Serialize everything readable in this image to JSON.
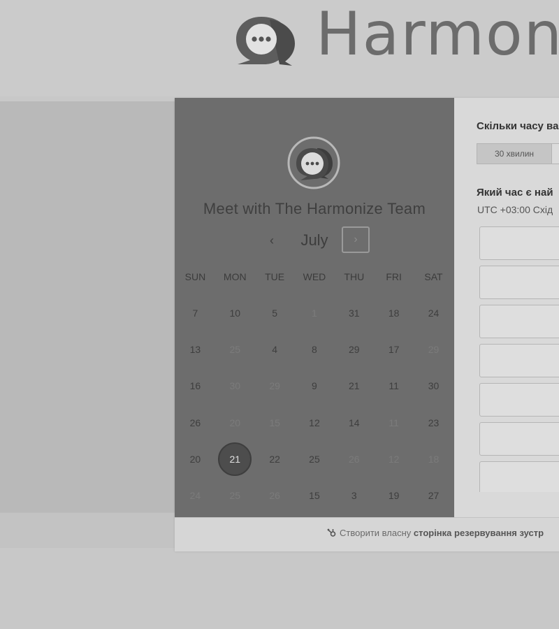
{
  "header": {
    "brand_name": "Harmon"
  },
  "calendar": {
    "team_title": "Meet with The Harmonize Team",
    "month": "July",
    "prev_icon": "chevron-left-icon",
    "next_icon": "chevron-right-icon",
    "prev_glyph": "‹",
    "next_glyph": "›",
    "weekdays": [
      "SUN",
      "MON",
      "TUE",
      "WED",
      "THU",
      "FRI",
      "SAT"
    ],
    "weeks": [
      [
        {
          "d": "7",
          "m": false
        },
        {
          "d": "10",
          "m": false
        },
        {
          "d": "5",
          "m": false
        },
        {
          "d": "1",
          "m": true
        },
        {
          "d": "31",
          "m": false
        },
        {
          "d": "18",
          "m": false
        },
        {
          "d": "24",
          "m": false
        }
      ],
      [
        {
          "d": "13",
          "m": false
        },
        {
          "d": "25",
          "m": true
        },
        {
          "d": "4",
          "m": false
        },
        {
          "d": "8",
          "m": false
        },
        {
          "d": "29",
          "m": false
        },
        {
          "d": "17",
          "m": false
        },
        {
          "d": "29",
          "m": true
        }
      ],
      [
        {
          "d": "16",
          "m": false
        },
        {
          "d": "30",
          "m": true
        },
        {
          "d": "29",
          "m": true
        },
        {
          "d": "9",
          "m": false
        },
        {
          "d": "21",
          "m": false
        },
        {
          "d": "11",
          "m": false
        },
        {
          "d": "30",
          "m": false
        }
      ],
      [
        {
          "d": "26",
          "m": false
        },
        {
          "d": "20",
          "m": true
        },
        {
          "d": "15",
          "m": true
        },
        {
          "d": "12",
          "m": false
        },
        {
          "d": "14",
          "m": false
        },
        {
          "d": "11",
          "m": true
        },
        {
          "d": "23",
          "m": false
        }
      ],
      [
        {
          "d": "20",
          "m": false
        },
        {
          "d": "21",
          "m": false,
          "s": true
        },
        {
          "d": "22",
          "m": false
        },
        {
          "d": "25",
          "m": false
        },
        {
          "d": "26",
          "m": true
        },
        {
          "d": "12",
          "m": true
        },
        {
          "d": "18",
          "m": true
        }
      ],
      [
        {
          "d": "24",
          "m": true
        },
        {
          "d": "25",
          "m": true
        },
        {
          "d": "26",
          "m": true
        },
        {
          "d": "15",
          "m": false
        },
        {
          "d": "3",
          "m": false
        },
        {
          "d": "19",
          "m": false
        },
        {
          "d": "27",
          "m": false
        }
      ]
    ]
  },
  "booking": {
    "duration_question": "Скільки часу ва",
    "duration_option": "30 хвилин",
    "time_question": "Який час є най",
    "timezone": "UTC +03:00 Схід",
    "slot_count": 7
  },
  "footer": {
    "icon": "hubspot-sprocket-icon",
    "text_plain": "Створити власну",
    "text_bold": "сторінка резервування зустр"
  },
  "colors": {
    "calendar_panel": "#6d6d6d",
    "selected_day": "#4d4d4d",
    "page_background": "#c8c8c8"
  }
}
